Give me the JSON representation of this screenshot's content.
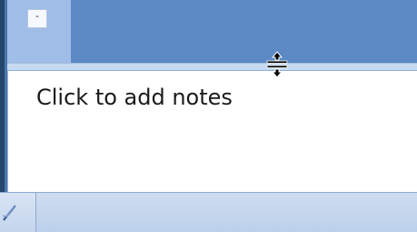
{
  "notes_pane": {
    "placeholder_text": "Click to add notes"
  },
  "slide_pane": {
    "collapse_button_glyph": "-"
  },
  "colors": {
    "header_blue": "#5a89c4",
    "strip_blue": "#9fbde6",
    "splitter": "#c7d9f1",
    "status_bar": "#c3d4ec"
  },
  "icons": {
    "cursor": "row-resize-cursor-icon",
    "status_tab": "pen-icon"
  }
}
